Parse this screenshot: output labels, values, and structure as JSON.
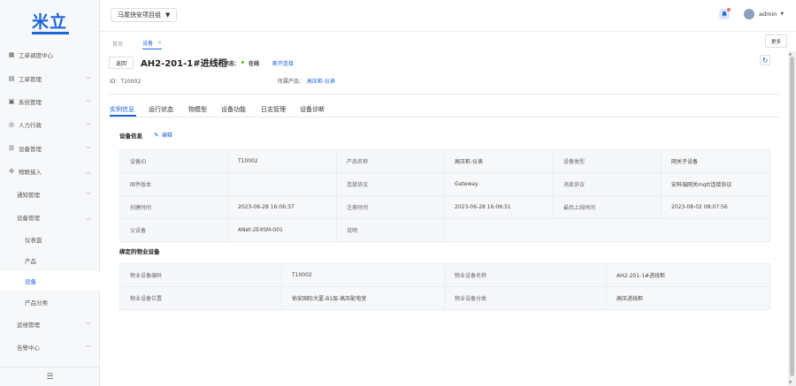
{
  "brand": {
    "logo_text": "米立",
    "color": "#1e64dc"
  },
  "sidebar": {
    "items": [
      {
        "label": "工单调度中心",
        "icon": "dispatch-icon"
      },
      {
        "label": "工单管理",
        "icon": "workorder-icon"
      },
      {
        "label": "系统管理",
        "icon": "system-icon"
      },
      {
        "label": "人力行政",
        "icon": "people-icon"
      },
      {
        "label": "设备管理",
        "icon": "device-icon"
      },
      {
        "label": "物联接入",
        "icon": "iot-icon"
      },
      {
        "label": "通知管理"
      },
      {
        "label": "设备管理"
      },
      {
        "label": "仪表盘"
      },
      {
        "label": "产品"
      },
      {
        "label": "设备"
      },
      {
        "label": "产品分类"
      },
      {
        "label": "运维管理"
      },
      {
        "label": "告警中心"
      }
    ]
  },
  "header": {
    "project": "马尾快安项目组",
    "user": "admin"
  },
  "tabs": {
    "home": "首页",
    "device": "设备",
    "close": "×",
    "more": "更多"
  },
  "device": {
    "back": "返回",
    "title": "AH2-201-1#进线柜",
    "status_label": "状态：",
    "status_value": "在线",
    "disconnect": "断开连接",
    "id_line": "ID：T10002",
    "product_label": "所属产品：",
    "product_value": "高压柜-仪表"
  },
  "inner_tabs": [
    "实例信息",
    "运行状态",
    "物模型",
    "设备功能",
    "日志管理",
    "设备诊断"
  ],
  "info_section": {
    "title": "设备信息",
    "edit": "编辑",
    "rows": [
      [
        "设备ID",
        "T10002",
        "产品名称",
        "高压柜-仪表",
        "设备类型",
        "网关子设备"
      ],
      [
        "固件版本",
        "",
        "连接协议",
        "Gateway",
        "消息协议",
        "安科瑞网关mqtt连接协议"
      ],
      [
        "创建时间",
        "2023-06-28 16:06:37",
        "注册时间",
        "2023-06-28 16:06:51",
        "最后上线时间",
        "2023-08-02 08:07:56"
      ],
      [
        "父设备",
        "ANet-2E4SM-001",
        "说明",
        "",
        "",
        ""
      ]
    ]
  },
  "bound_section": {
    "title": "绑定的物业设备",
    "rows": [
      [
        "物业设备编码",
        "T10002",
        "物业设备名称",
        "AH2-201-1#进线柜"
      ],
      [
        "物业设备位置",
        "佑安国际大厦-B1层-高压配电室",
        "物业设备分类",
        "高压进线柜"
      ]
    ]
  }
}
